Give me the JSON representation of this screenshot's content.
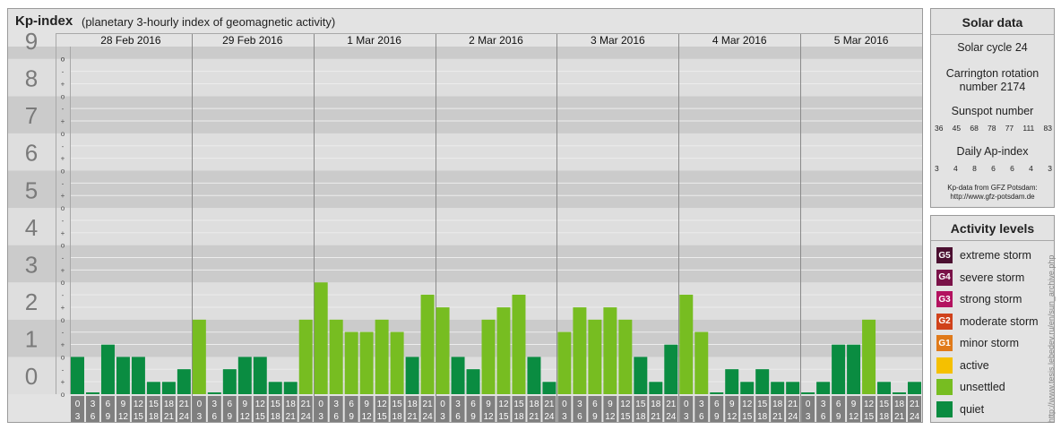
{
  "header": {
    "title": "Kp-index",
    "subtitle": "(planetary 3-hourly index of geomagnetic activity)"
  },
  "chart_data": {
    "type": "bar",
    "y_axis": {
      "min": 0,
      "max": 9.33,
      "major_labels": [
        "0",
        "1",
        "2",
        "3",
        "4",
        "5",
        "6",
        "7",
        "8",
        "9"
      ],
      "minor_labels": [
        "o",
        "+",
        "-",
        "o"
      ]
    },
    "days": [
      "28 Feb 2016",
      "29 Feb 2016",
      "1 Mar 2016",
      "2 Mar 2016",
      "3 Mar 2016",
      "4 Mar 2016",
      "5 Mar 2016"
    ],
    "slot_labels": [
      [
        "0",
        "3"
      ],
      [
        "3",
        "6"
      ],
      [
        "6",
        "9"
      ],
      [
        "9",
        "12"
      ],
      [
        "12",
        "15"
      ],
      [
        "15",
        "18"
      ],
      [
        "18",
        "21"
      ],
      [
        "21",
        "24"
      ]
    ],
    "values": [
      1.0,
      0.0,
      1.33,
      1.0,
      1.0,
      0.33,
      0.33,
      0.67,
      2.0,
      0.0,
      0.67,
      1.0,
      1.0,
      0.33,
      0.33,
      2.0,
      3.0,
      2.0,
      1.67,
      1.67,
      2.0,
      1.67,
      1.0,
      2.67,
      2.33,
      1.0,
      0.67,
      2.0,
      2.33,
      2.67,
      1.0,
      0.33,
      1.67,
      2.33,
      2.0,
      2.33,
      2.0,
      1.0,
      0.33,
      1.33,
      2.67,
      1.67,
      0.0,
      0.67,
      0.33,
      0.67,
      0.33,
      0.33,
      0.0,
      0.33,
      1.33,
      1.33,
      2.0,
      0.33,
      0.0,
      0.33
    ],
    "colors": {
      "quiet": "#0a8c41",
      "unsettled": "#77bd21",
      "band_dark": "#cbcbcb",
      "band_light": "#dedede",
      "tick_box": "#7f7f7f",
      "axis_label": "#7a7a7a"
    }
  },
  "solar": {
    "title": "Solar data",
    "cycle": "Solar cycle 24",
    "carrington_line1": "Carrington rotation",
    "carrington_line2": "number 2174",
    "sunspot_title": "Sunspot number",
    "sunspot_values": [
      "36",
      "45",
      "68",
      "78",
      "77",
      "111",
      "83"
    ],
    "ap_title": "Daily Ap-index",
    "ap_values": [
      "3",
      "4",
      "8",
      "6",
      "6",
      "4",
      "3"
    ],
    "source_line1": "Kp-data from GFZ Potsdam:",
    "source_line2": "http://www.gfz-potsdam.de"
  },
  "activity": {
    "title": "Activity levels",
    "levels": [
      {
        "code": "G5",
        "label": "extreme storm",
        "color": "#4b0f30"
      },
      {
        "code": "G4",
        "label": "severe storm",
        "color": "#7a1248"
      },
      {
        "code": "G3",
        "label": "strong storm",
        "color": "#b3125f"
      },
      {
        "code": "G2",
        "label": "moderate storm",
        "color": "#d0421b"
      },
      {
        "code": "G1",
        "label": "minor storm",
        "color": "#e07a1a"
      },
      {
        "code": "",
        "label": "active",
        "color": "#f5c000"
      },
      {
        "code": "",
        "label": "unsettled",
        "color": "#77bd21"
      },
      {
        "code": "",
        "label": "quiet",
        "color": "#0a8c41"
      }
    ]
  },
  "credit": "http://www.tesis.lebedev.ru/en/sun_archive.php"
}
